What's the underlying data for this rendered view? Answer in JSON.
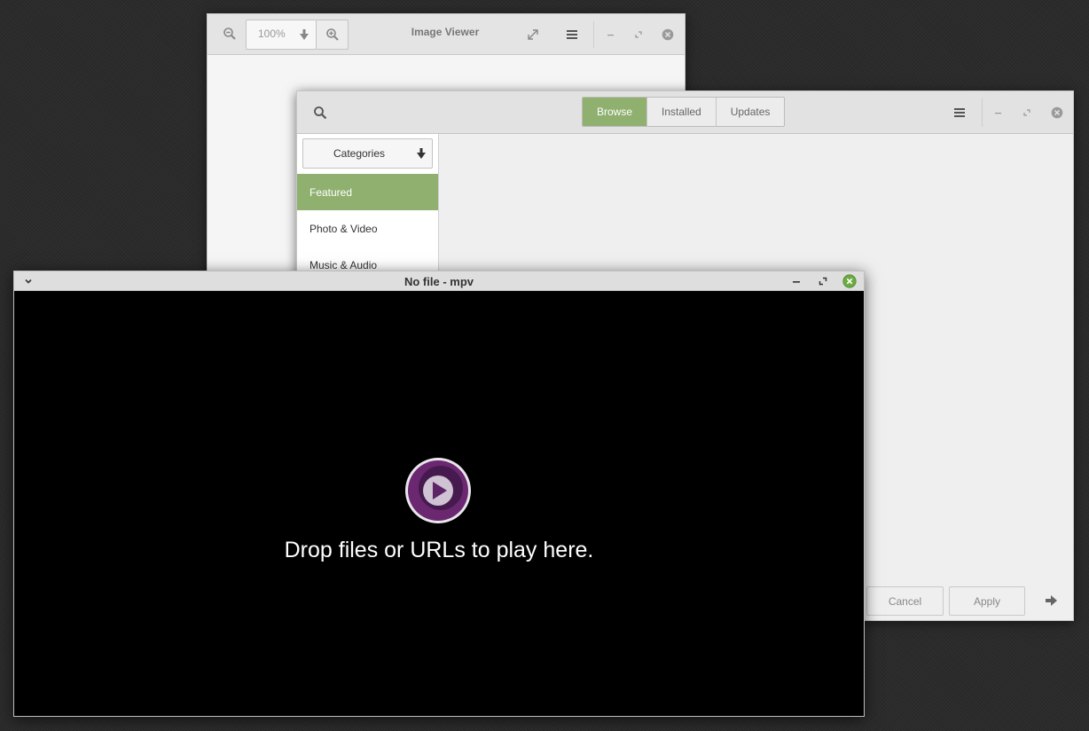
{
  "image_viewer": {
    "title": "Image Viewer",
    "zoom_value": "100%",
    "icons": {
      "zoom_out": "zoom-out-icon",
      "zoom_dropdown": "dropdown-arrow-icon",
      "zoom_in": "zoom-in-icon",
      "fullscreen": "fullscreen-icon",
      "menu": "hamburger-menu-icon",
      "minimize": "minimize-icon",
      "maximize": "maximize-icon",
      "close": "close-icon"
    }
  },
  "software_manager": {
    "tabs": [
      {
        "label": "Browse",
        "active": true
      },
      {
        "label": "Installed",
        "active": false
      },
      {
        "label": "Updates",
        "active": false
      }
    ],
    "category_select_label": "Categories",
    "categories": [
      {
        "label": "Featured",
        "active": true
      },
      {
        "label": "Photo & Video",
        "active": false
      },
      {
        "label": "Music & Audio",
        "active": false
      }
    ],
    "cancel_label": "Cancel",
    "apply_label": "Apply",
    "accent_color": "#8fb06f"
  },
  "mpv": {
    "title": "No file - mpv",
    "drop_message": "Drop files or URLs to play here.",
    "logo": "mpv-logo",
    "close_color": "#6cab42"
  }
}
